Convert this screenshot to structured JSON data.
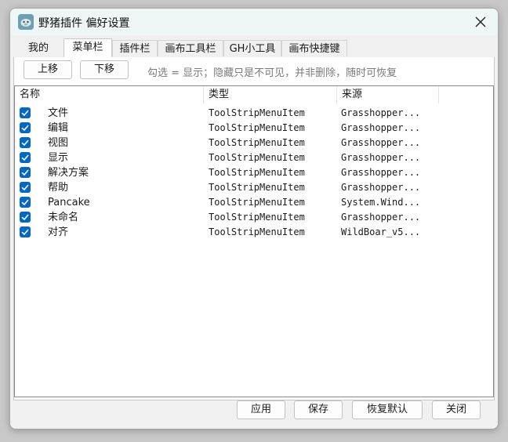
{
  "window": {
    "title": "野猪插件 偏好设置"
  },
  "tabs": [
    {
      "label": "我的",
      "active": false
    },
    {
      "label": "菜单栏",
      "active": true
    },
    {
      "label": "插件栏",
      "active": false
    },
    {
      "label": "画布工具栏",
      "active": false
    },
    {
      "label": "GH小工具",
      "active": false
    },
    {
      "label": "画布快捷键",
      "active": false
    }
  ],
  "toolbar": {
    "move_up_label": "上移",
    "move_down_label": "下移",
    "hint": "勾选 = 显示；隐藏只是不可见，并非删除，随时可恢复"
  },
  "list": {
    "columns": [
      "名称",
      "类型",
      "来源"
    ],
    "rows": [
      {
        "checked": true,
        "name": "文件",
        "type": "ToolStripMenuItem",
        "source": "Grasshopper..."
      },
      {
        "checked": true,
        "name": "编辑",
        "type": "ToolStripMenuItem",
        "source": "Grasshopper..."
      },
      {
        "checked": true,
        "name": "视图",
        "type": "ToolStripMenuItem",
        "source": "Grasshopper..."
      },
      {
        "checked": true,
        "name": "显示",
        "type": "ToolStripMenuItem",
        "source": "Grasshopper..."
      },
      {
        "checked": true,
        "name": "解决方案",
        "type": "ToolStripMenuItem",
        "source": "Grasshopper..."
      },
      {
        "checked": true,
        "name": "帮助",
        "type": "ToolStripMenuItem",
        "source": "Grasshopper..."
      },
      {
        "checked": true,
        "name": "Pancake",
        "type": "ToolStripMenuItem",
        "source": "System.Wind..."
      },
      {
        "checked": true,
        "name": "未命名",
        "type": "ToolStripMenuItem",
        "source": "Grasshopper..."
      },
      {
        "checked": true,
        "name": "对齐",
        "type": "ToolStripMenuItem",
        "source": "WildBoar_v5..."
      }
    ]
  },
  "footer": {
    "apply_label": "应用",
    "save_label": "保存",
    "restore_defaults_label": "恢复默认",
    "close_label": "关闭"
  },
  "colors": {
    "checkbox": "#0067c0",
    "window_bg": "#f0f0f0",
    "titlebar_bg": "#eef6f7"
  }
}
